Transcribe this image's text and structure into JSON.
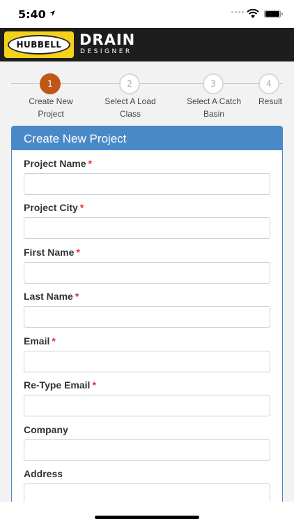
{
  "status_bar": {
    "time": "5:40"
  },
  "header": {
    "logo_text": "HUBBELL",
    "brand_main": "DRAIN",
    "brand_sub": "DESIGNER"
  },
  "stepper": {
    "steps": [
      {
        "number": "1",
        "label_line1": "Create New",
        "label_line2": "Project"
      },
      {
        "number": "2",
        "label_line1": "Select A Load",
        "label_line2": "Class"
      },
      {
        "number": "3",
        "label_line1": "Select A Catch",
        "label_line2": "Basin"
      },
      {
        "number": "4",
        "label_line1": "Result",
        "label_line2": ""
      }
    ]
  },
  "form": {
    "title": "Create New Project",
    "required_marker": "*",
    "fields": [
      {
        "label": "Project Name",
        "value": ""
      },
      {
        "label": "Project City",
        "value": ""
      },
      {
        "label": "First Name",
        "value": ""
      },
      {
        "label": "Last Name",
        "value": ""
      },
      {
        "label": "Email",
        "value": ""
      },
      {
        "label": "Re-Type Email",
        "value": ""
      },
      {
        "label": "Company",
        "value": ""
      },
      {
        "label": "Address",
        "value": ""
      }
    ]
  },
  "colors": {
    "accent": "#4a89c8",
    "active_step": "#c05617",
    "header_bg": "#1d1d1d",
    "logo_bg": "#f5d21a"
  }
}
